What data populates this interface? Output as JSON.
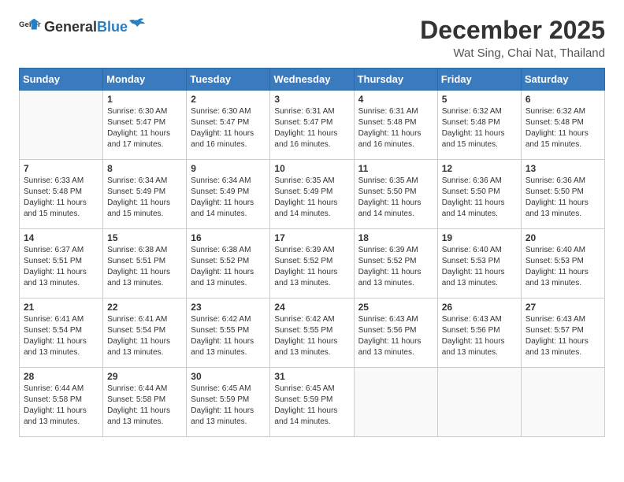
{
  "header": {
    "logo_general": "General",
    "logo_blue": "Blue",
    "month_year": "December 2025",
    "location": "Wat Sing, Chai Nat, Thailand"
  },
  "weekdays": [
    "Sunday",
    "Monday",
    "Tuesday",
    "Wednesday",
    "Thursday",
    "Friday",
    "Saturday"
  ],
  "weeks": [
    [
      {
        "day": "",
        "sunrise": "",
        "sunset": "",
        "daylight": ""
      },
      {
        "day": "1",
        "sunrise": "Sunrise: 6:30 AM",
        "sunset": "Sunset: 5:47 PM",
        "daylight": "Daylight: 11 hours and 17 minutes."
      },
      {
        "day": "2",
        "sunrise": "Sunrise: 6:30 AM",
        "sunset": "Sunset: 5:47 PM",
        "daylight": "Daylight: 11 hours and 16 minutes."
      },
      {
        "day": "3",
        "sunrise": "Sunrise: 6:31 AM",
        "sunset": "Sunset: 5:47 PM",
        "daylight": "Daylight: 11 hours and 16 minutes."
      },
      {
        "day": "4",
        "sunrise": "Sunrise: 6:31 AM",
        "sunset": "Sunset: 5:48 PM",
        "daylight": "Daylight: 11 hours and 16 minutes."
      },
      {
        "day": "5",
        "sunrise": "Sunrise: 6:32 AM",
        "sunset": "Sunset: 5:48 PM",
        "daylight": "Daylight: 11 hours and 15 minutes."
      },
      {
        "day": "6",
        "sunrise": "Sunrise: 6:32 AM",
        "sunset": "Sunset: 5:48 PM",
        "daylight": "Daylight: 11 hours and 15 minutes."
      }
    ],
    [
      {
        "day": "7",
        "sunrise": "Sunrise: 6:33 AM",
        "sunset": "Sunset: 5:48 PM",
        "daylight": "Daylight: 11 hours and 15 minutes."
      },
      {
        "day": "8",
        "sunrise": "Sunrise: 6:34 AM",
        "sunset": "Sunset: 5:49 PM",
        "daylight": "Daylight: 11 hours and 15 minutes."
      },
      {
        "day": "9",
        "sunrise": "Sunrise: 6:34 AM",
        "sunset": "Sunset: 5:49 PM",
        "daylight": "Daylight: 11 hours and 14 minutes."
      },
      {
        "day": "10",
        "sunrise": "Sunrise: 6:35 AM",
        "sunset": "Sunset: 5:49 PM",
        "daylight": "Daylight: 11 hours and 14 minutes."
      },
      {
        "day": "11",
        "sunrise": "Sunrise: 6:35 AM",
        "sunset": "Sunset: 5:50 PM",
        "daylight": "Daylight: 11 hours and 14 minutes."
      },
      {
        "day": "12",
        "sunrise": "Sunrise: 6:36 AM",
        "sunset": "Sunset: 5:50 PM",
        "daylight": "Daylight: 11 hours and 14 minutes."
      },
      {
        "day": "13",
        "sunrise": "Sunrise: 6:36 AM",
        "sunset": "Sunset: 5:50 PM",
        "daylight": "Daylight: 11 hours and 13 minutes."
      }
    ],
    [
      {
        "day": "14",
        "sunrise": "Sunrise: 6:37 AM",
        "sunset": "Sunset: 5:51 PM",
        "daylight": "Daylight: 11 hours and 13 minutes."
      },
      {
        "day": "15",
        "sunrise": "Sunrise: 6:38 AM",
        "sunset": "Sunset: 5:51 PM",
        "daylight": "Daylight: 11 hours and 13 minutes."
      },
      {
        "day": "16",
        "sunrise": "Sunrise: 6:38 AM",
        "sunset": "Sunset: 5:52 PM",
        "daylight": "Daylight: 11 hours and 13 minutes."
      },
      {
        "day": "17",
        "sunrise": "Sunrise: 6:39 AM",
        "sunset": "Sunset: 5:52 PM",
        "daylight": "Daylight: 11 hours and 13 minutes."
      },
      {
        "day": "18",
        "sunrise": "Sunrise: 6:39 AM",
        "sunset": "Sunset: 5:52 PM",
        "daylight": "Daylight: 11 hours and 13 minutes."
      },
      {
        "day": "19",
        "sunrise": "Sunrise: 6:40 AM",
        "sunset": "Sunset: 5:53 PM",
        "daylight": "Daylight: 11 hours and 13 minutes."
      },
      {
        "day": "20",
        "sunrise": "Sunrise: 6:40 AM",
        "sunset": "Sunset: 5:53 PM",
        "daylight": "Daylight: 11 hours and 13 minutes."
      }
    ],
    [
      {
        "day": "21",
        "sunrise": "Sunrise: 6:41 AM",
        "sunset": "Sunset: 5:54 PM",
        "daylight": "Daylight: 11 hours and 13 minutes."
      },
      {
        "day": "22",
        "sunrise": "Sunrise: 6:41 AM",
        "sunset": "Sunset: 5:54 PM",
        "daylight": "Daylight: 11 hours and 13 minutes."
      },
      {
        "day": "23",
        "sunrise": "Sunrise: 6:42 AM",
        "sunset": "Sunset: 5:55 PM",
        "daylight": "Daylight: 11 hours and 13 minutes."
      },
      {
        "day": "24",
        "sunrise": "Sunrise: 6:42 AM",
        "sunset": "Sunset: 5:55 PM",
        "daylight": "Daylight: 11 hours and 13 minutes."
      },
      {
        "day": "25",
        "sunrise": "Sunrise: 6:43 AM",
        "sunset": "Sunset: 5:56 PM",
        "daylight": "Daylight: 11 hours and 13 minutes."
      },
      {
        "day": "26",
        "sunrise": "Sunrise: 6:43 AM",
        "sunset": "Sunset: 5:56 PM",
        "daylight": "Daylight: 11 hours and 13 minutes."
      },
      {
        "day": "27",
        "sunrise": "Sunrise: 6:43 AM",
        "sunset": "Sunset: 5:57 PM",
        "daylight": "Daylight: 11 hours and 13 minutes."
      }
    ],
    [
      {
        "day": "28",
        "sunrise": "Sunrise: 6:44 AM",
        "sunset": "Sunset: 5:58 PM",
        "daylight": "Daylight: 11 hours and 13 minutes."
      },
      {
        "day": "29",
        "sunrise": "Sunrise: 6:44 AM",
        "sunset": "Sunset: 5:58 PM",
        "daylight": "Daylight: 11 hours and 13 minutes."
      },
      {
        "day": "30",
        "sunrise": "Sunrise: 6:45 AM",
        "sunset": "Sunset: 5:59 PM",
        "daylight": "Daylight: 11 hours and 13 minutes."
      },
      {
        "day": "31",
        "sunrise": "Sunrise: 6:45 AM",
        "sunset": "Sunset: 5:59 PM",
        "daylight": "Daylight: 11 hours and 14 minutes."
      },
      {
        "day": "",
        "sunrise": "",
        "sunset": "",
        "daylight": ""
      },
      {
        "day": "",
        "sunrise": "",
        "sunset": "",
        "daylight": ""
      },
      {
        "day": "",
        "sunrise": "",
        "sunset": "",
        "daylight": ""
      }
    ]
  ]
}
